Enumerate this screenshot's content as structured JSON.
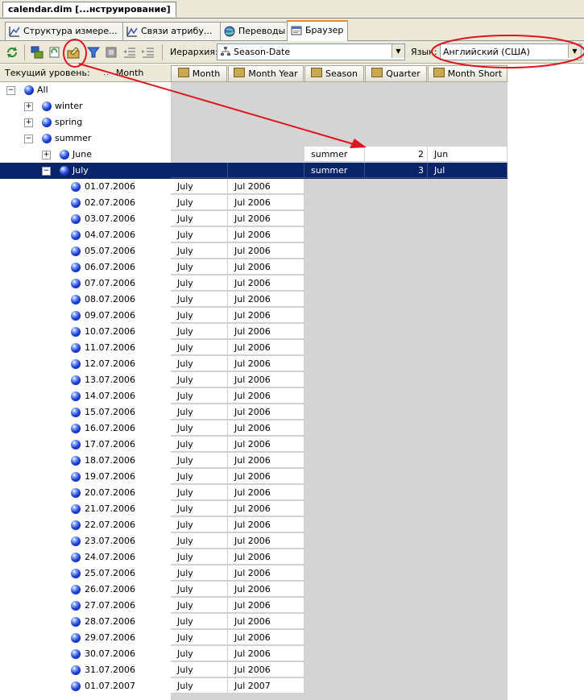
{
  "document_tab": "calendar.dim [...нструирование]",
  "designer_tabs": [
    {
      "label": "Структура измере..."
    },
    {
      "label": "Связи атрибу..."
    },
    {
      "label": "Переводы"
    },
    {
      "label": "Браузер"
    }
  ],
  "toolbar": {
    "hierarchy_label": "Иерархия:",
    "hierarchy_value": "Season-Date",
    "language_label": "Язык:",
    "language_value": "Английский (США)"
  },
  "grid": {
    "current_level_label": "Текущий уровень:",
    "current_level_value": "Month",
    "columns": [
      "Month",
      "Month Year",
      "Season",
      "Quarter",
      "Month Short"
    ],
    "tree": [
      {
        "label": "All",
        "depth": 0,
        "expander": "−"
      },
      {
        "label": "winter",
        "depth": 1,
        "expander": "+"
      },
      {
        "label": "spring",
        "depth": 1,
        "expander": "+"
      },
      {
        "label": "summer",
        "depth": 1,
        "expander": "−"
      },
      {
        "label": "June",
        "depth": 2,
        "expander": "+",
        "season": "summer",
        "quarter": "2",
        "month_short": "Jun"
      },
      {
        "label": "July",
        "depth": 2,
        "expander": "−",
        "season": "summer",
        "quarter": "3",
        "month_short": "Jul",
        "selected": true
      }
    ],
    "dates": [
      {
        "date": "01.07.2006",
        "month": "July",
        "month_year": "Jul 2006"
      },
      {
        "date": "02.07.2006",
        "month": "July",
        "month_year": "Jul 2006"
      },
      {
        "date": "03.07.2006",
        "month": "July",
        "month_year": "Jul 2006"
      },
      {
        "date": "04.07.2006",
        "month": "July",
        "month_year": "Jul 2006"
      },
      {
        "date": "05.07.2006",
        "month": "July",
        "month_year": "Jul 2006"
      },
      {
        "date": "06.07.2006",
        "month": "July",
        "month_year": "Jul 2006"
      },
      {
        "date": "07.07.2006",
        "month": "July",
        "month_year": "Jul 2006"
      },
      {
        "date": "08.07.2006",
        "month": "July",
        "month_year": "Jul 2006"
      },
      {
        "date": "09.07.2006",
        "month": "July",
        "month_year": "Jul 2006"
      },
      {
        "date": "10.07.2006",
        "month": "July",
        "month_year": "Jul 2006"
      },
      {
        "date": "11.07.2006",
        "month": "July",
        "month_year": "Jul 2006"
      },
      {
        "date": "12.07.2006",
        "month": "July",
        "month_year": "Jul 2006"
      },
      {
        "date": "13.07.2006",
        "month": "July",
        "month_year": "Jul 2006"
      },
      {
        "date": "14.07.2006",
        "month": "July",
        "month_year": "Jul 2006"
      },
      {
        "date": "15.07.2006",
        "month": "July",
        "month_year": "Jul 2006"
      },
      {
        "date": "16.07.2006",
        "month": "July",
        "month_year": "Jul 2006"
      },
      {
        "date": "17.07.2006",
        "month": "July",
        "month_year": "Jul 2006"
      },
      {
        "date": "18.07.2006",
        "month": "July",
        "month_year": "Jul 2006"
      },
      {
        "date": "19.07.2006",
        "month": "July",
        "month_year": "Jul 2006"
      },
      {
        "date": "20.07.2006",
        "month": "July",
        "month_year": "Jul 2006"
      },
      {
        "date": "21.07.2006",
        "month": "July",
        "month_year": "Jul 2006"
      },
      {
        "date": "22.07.2006",
        "month": "July",
        "month_year": "Jul 2006"
      },
      {
        "date": "23.07.2006",
        "month": "July",
        "month_year": "Jul 2006"
      },
      {
        "date": "24.07.2006",
        "month": "July",
        "month_year": "Jul 2006"
      },
      {
        "date": "25.07.2006",
        "month": "July",
        "month_year": "Jul 2006"
      },
      {
        "date": "26.07.2006",
        "month": "July",
        "month_year": "Jul 2006"
      },
      {
        "date": "27.07.2006",
        "month": "July",
        "month_year": "Jul 2006"
      },
      {
        "date": "28.07.2006",
        "month": "July",
        "month_year": "Jul 2006"
      },
      {
        "date": "29.07.2006",
        "month": "July",
        "month_year": "Jul 2006"
      },
      {
        "date": "30.07.2006",
        "month": "July",
        "month_year": "Jul 2006"
      },
      {
        "date": "31.07.2006",
        "month": "July",
        "month_year": "Jul 2006"
      },
      {
        "date": "01.07.2007",
        "month": "July",
        "month_year": "Jul 2007"
      }
    ]
  },
  "colors": {
    "selection": "#0a246a",
    "annotation": "#e0141e",
    "tab_highlight": "#e68b2c"
  }
}
